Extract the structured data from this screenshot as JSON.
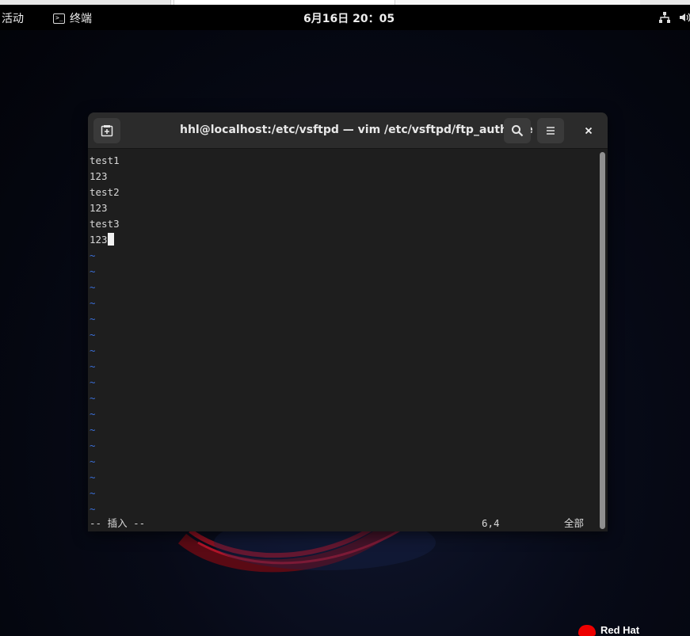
{
  "topbar": {
    "activities": "活动",
    "app_name": "终端",
    "clock": "6月16日  20：05",
    "tray_icons": [
      "network-icon",
      "volume-icon"
    ]
  },
  "terminal": {
    "title": "hhl@localhost:/etc/vsftpd — vim /etc/vsftpd/ftp_auth_file",
    "lines": [
      "test1",
      "123",
      "test2",
      "123",
      "test3",
      "123"
    ],
    "tilde": "~",
    "status_mode": "-- 插入 --",
    "status_position": "6,4",
    "status_percent": "全部"
  },
  "branding": {
    "logo_text": "Red Hat"
  },
  "colors": {
    "tilde": "#3b6fd8",
    "terminal_bg": "#1e1e1e",
    "header_bg": "#2b2b2b",
    "redhat_red": "#ee0000"
  }
}
